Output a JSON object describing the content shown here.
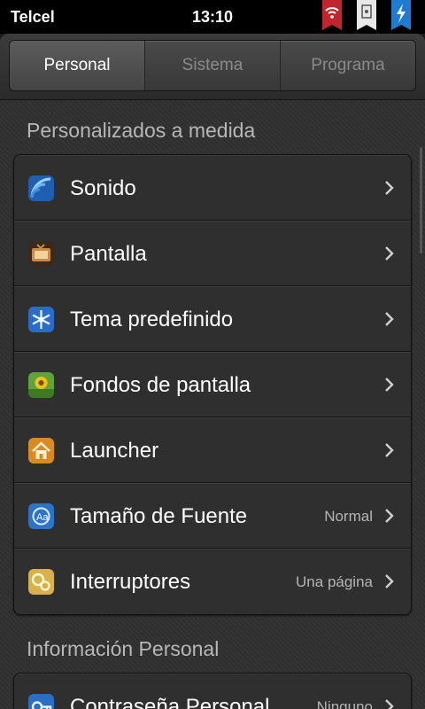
{
  "status_bar": {
    "carrier": "Telcel",
    "time": "13:10",
    "icons": [
      "wifi-icon",
      "notification-icon",
      "charging-icon"
    ]
  },
  "tabs": [
    {
      "label": "Personal",
      "active": true
    },
    {
      "label": "Sistema",
      "active": false
    },
    {
      "label": "Programa",
      "active": false
    }
  ],
  "sections": [
    {
      "title": "Personalizados a medida",
      "items": [
        {
          "label": "Sonido",
          "value": "",
          "icon": "sound-icon"
        },
        {
          "label": "Pantalla",
          "value": "",
          "icon": "display-icon"
        },
        {
          "label": "Tema predefinido",
          "value": "",
          "icon": "theme-icon"
        },
        {
          "label": "Fondos de pantalla",
          "value": "",
          "icon": "wallpaper-icon"
        },
        {
          "label": "Launcher",
          "value": "",
          "icon": "launcher-icon"
        },
        {
          "label": "Tamaño de Fuente",
          "value": "Normal",
          "icon": "font-size-icon"
        },
        {
          "label": "Interruptores",
          "value": "Una página",
          "icon": "toggles-icon"
        }
      ]
    },
    {
      "title": "Información Personal",
      "items": [
        {
          "label": "Contraseña Personal",
          "value": "Ninguno",
          "icon": "password-icon"
        }
      ]
    }
  ],
  "colors": {
    "status_bar_bg": "#000000",
    "background": "#2f2f2f",
    "text_primary": "#ffffff",
    "text_secondary": "#b4b4b4",
    "section_title": "#b7b7b7"
  }
}
